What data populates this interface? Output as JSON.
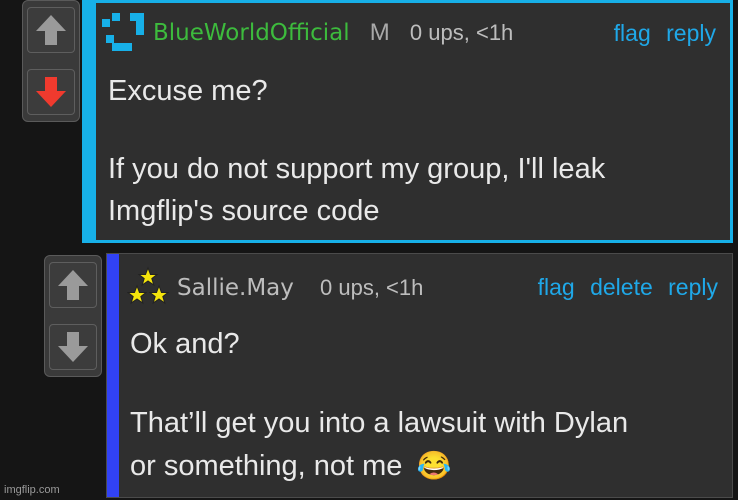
{
  "comments": [
    {
      "username": "BlueWorldOfficial",
      "username_color": "#3dbb3d",
      "rank": "M",
      "stats": "0 ups, <1h",
      "actions": [
        "flag",
        "reply"
      ],
      "lines": [
        "Excuse me?",
        "If you do not support my group, I'll leak",
        "Imgflip's source code"
      ],
      "accent": "#17b0e8",
      "upvote_active": false,
      "downvote_active": true
    },
    {
      "username": "Sallie.May",
      "username_color": "#bdbdbd",
      "stats": "0 ups, <1h",
      "actions": [
        "flag",
        "delete",
        "reply"
      ],
      "lines": [
        "Ok and?",
        "That’ll get you into a lawsuit with Dylan",
        "or something, not me"
      ],
      "emoji": "😂",
      "accent": "#3142f5",
      "upvote_active": false,
      "downvote_active": false
    }
  ],
  "watermark": "imgflip.com"
}
